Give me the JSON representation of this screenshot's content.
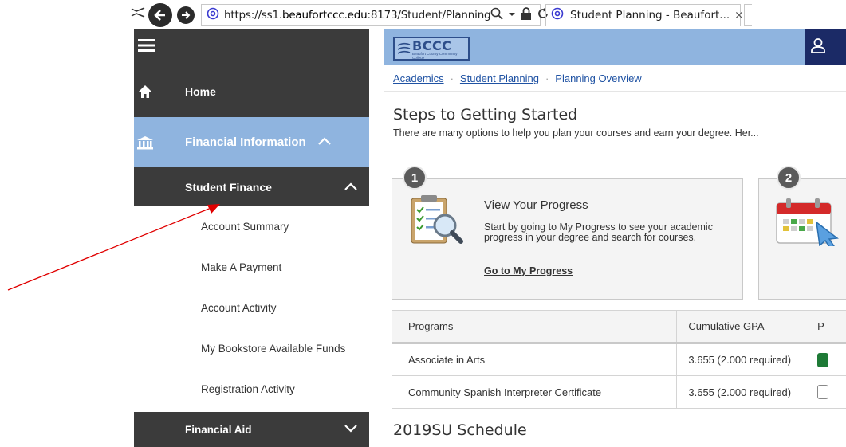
{
  "browser": {
    "url_prefix": "https://ss1.",
    "url_host": "beaufortccc.edu",
    "url_rest": ":8173/Student/Planning",
    "search_icon": "search-icon",
    "tab_title": "Student Planning - Beaufort...",
    "tab_close": "×"
  },
  "sidebar": {
    "home": "Home",
    "financial_information": "Financial Information",
    "student_finance": "Student Finance",
    "items": [
      "Account Summary",
      "Make A Payment",
      "Account Activity",
      "My Bookstore Available Funds",
      "Registration Activity"
    ],
    "financial_aid": "Financial Aid"
  },
  "header": {
    "logo_text": "BCCC",
    "logo_subtext": "Beaufort County Community College"
  },
  "breadcrumb": {
    "items": [
      "Academics",
      "Student Planning",
      "Planning Overview"
    ],
    "separator": "·"
  },
  "steps": {
    "title": "Steps to Getting Started",
    "description": "There are many options to help you plan your courses and earn your degree. Her...",
    "cards": [
      {
        "number": "1",
        "title": "View Your Progress",
        "text": "Start by going to My Progress to see your academic progress in your degree and search for courses.",
        "link": "Go to My Progress"
      },
      {
        "number": "2"
      }
    ]
  },
  "programs": {
    "headers": [
      "Programs",
      "Cumulative GPA",
      "P"
    ],
    "rows": [
      {
        "name": "Associate in Arts",
        "gpa": "3.655 (2.000 required)",
        "checked": true
      },
      {
        "name": "Community Spanish Interpreter Certificate",
        "gpa": "3.655 (2.000 required)",
        "checked": false
      }
    ]
  },
  "schedule": {
    "title": "2019SU Schedule"
  },
  "colors": {
    "sidebar_dark": "#3b3b3b",
    "accent_blue": "#8fb4df",
    "navy": "#1b2a66",
    "link_blue": "#1f52a3",
    "annotation_red": "#e00000"
  }
}
